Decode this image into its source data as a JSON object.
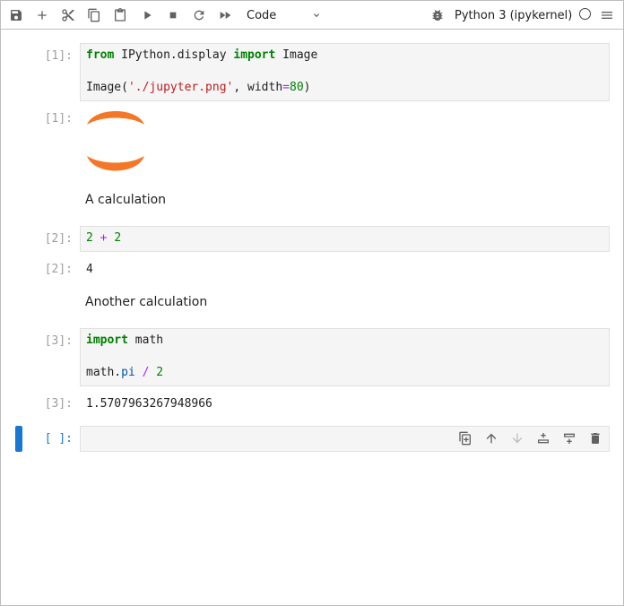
{
  "toolbar": {
    "buttons": [
      {
        "name": "save",
        "icon": "save-icon"
      },
      {
        "name": "insert-cell",
        "icon": "plus-icon"
      },
      {
        "name": "cut",
        "icon": "scissors-icon"
      },
      {
        "name": "copy",
        "icon": "copy-icon"
      },
      {
        "name": "paste",
        "icon": "paste-icon"
      },
      {
        "name": "run",
        "icon": "play-icon"
      },
      {
        "name": "interrupt",
        "icon": "stop-icon"
      },
      {
        "name": "restart",
        "icon": "refresh-icon"
      },
      {
        "name": "restart-run-all",
        "icon": "fast-forward-icon"
      }
    ],
    "cell_type": "Code",
    "kernel_name": "Python 3 (ipykernel)"
  },
  "cells": [
    {
      "prompt": "[1]:",
      "code_lines": [
        {
          "tokens": [
            [
              "kw",
              "from"
            ],
            [
              "plain",
              " IPython.display "
            ],
            [
              "kw",
              "import"
            ],
            [
              "plain",
              " Image"
            ]
          ]
        },
        {
          "tokens": []
        },
        {
          "tokens": [
            [
              "plain",
              "Image("
            ],
            [
              "str",
              "'./jupyter.png'"
            ],
            [
              "plain",
              ", width"
            ],
            [
              "op",
              "="
            ],
            [
              "num",
              "80"
            ],
            [
              "plain",
              ")"
            ]
          ]
        }
      ],
      "output_prompt": "[1]:"
    },
    {
      "markdown": "A calculation"
    },
    {
      "prompt": "[2]:",
      "code_lines": [
        {
          "tokens": [
            [
              "num",
              "2"
            ],
            [
              "plain",
              " "
            ],
            [
              "op",
              "+"
            ],
            [
              "plain",
              " "
            ],
            [
              "num",
              "2"
            ]
          ]
        }
      ],
      "output_prompt": "[2]:",
      "output": "4"
    },
    {
      "markdown": "Another calculation"
    },
    {
      "prompt": "[3]:",
      "code_lines": [
        {
          "tokens": [
            [
              "kw",
              "import"
            ],
            [
              "plain",
              " math"
            ]
          ]
        },
        {
          "tokens": []
        },
        {
          "tokens": [
            [
              "plain",
              "math."
            ],
            [
              "attr",
              "pi"
            ],
            [
              "plain",
              " "
            ],
            [
              "op",
              "/"
            ],
            [
              "plain",
              " "
            ],
            [
              "num",
              "2"
            ]
          ]
        }
      ],
      "output_prompt": "[3]:",
      "output": "1.5707963267948966"
    },
    {
      "prompt": "[ ]:",
      "active": true
    }
  ],
  "colors": {
    "accent": "#1976d2",
    "jupyter_orange": "#f37726"
  }
}
